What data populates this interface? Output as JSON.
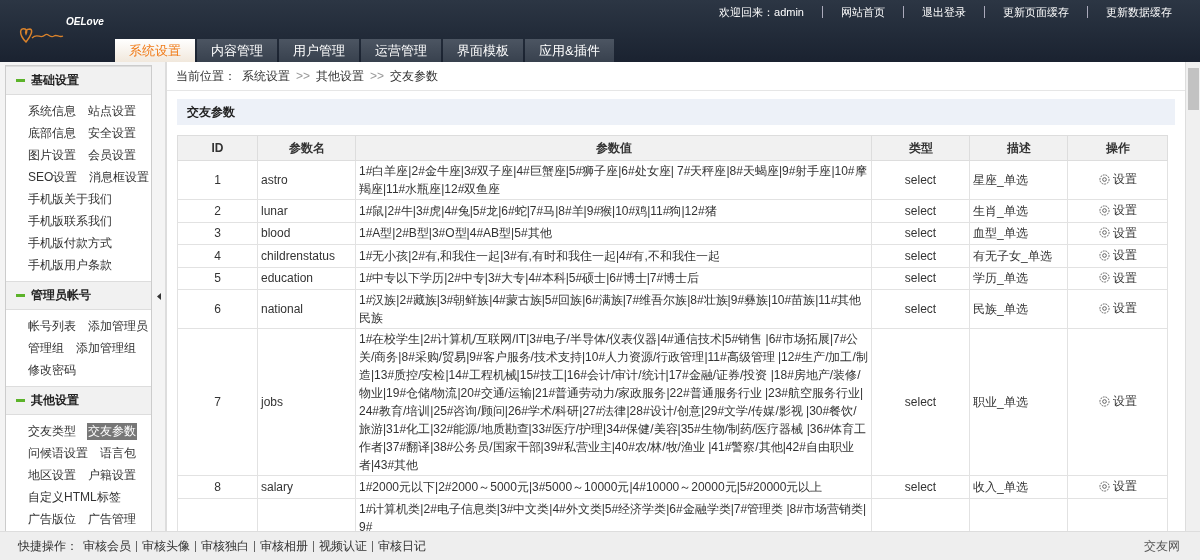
{
  "header": {
    "logo": "OELove",
    "links": [
      "欢迎回来：admin",
      "网站首页",
      "退出登录",
      "更新页面缓存",
      "更新数据缓存"
    ],
    "tabs": [
      {
        "label": "系统设置",
        "selected": true
      },
      {
        "label": "内容管理",
        "selected": false
      },
      {
        "label": "用户管理",
        "selected": false
      },
      {
        "label": "运营管理",
        "selected": false
      },
      {
        "label": "界面模板",
        "selected": false
      },
      {
        "label": "应用&插件",
        "selected": false
      }
    ]
  },
  "sidebar": {
    "groups": [
      {
        "title": "基础设置",
        "expanded": true,
        "rows": [
          [
            {
              "label": "系统信息",
              "selected": false
            },
            {
              "label": "站点设置",
              "selected": false
            }
          ],
          [
            {
              "label": "底部信息",
              "selected": false
            },
            {
              "label": "安全设置",
              "selected": false
            }
          ],
          [
            {
              "label": "图片设置",
              "selected": false
            },
            {
              "label": "会员设置",
              "selected": false
            }
          ],
          [
            {
              "label": "SEO设置",
              "selected": false
            },
            {
              "label": "消息框设置",
              "selected": false
            }
          ],
          [
            {
              "label": "手机版关于我们",
              "selected": false
            }
          ],
          [
            {
              "label": "手机版联系我们",
              "selected": false
            }
          ],
          [
            {
              "label": "手机版付款方式",
              "selected": false
            }
          ],
          [
            {
              "label": "手机版用户条款",
              "selected": false
            }
          ]
        ]
      },
      {
        "title": "管理员帐号",
        "expanded": true,
        "rows": [
          [
            {
              "label": "帐号列表",
              "selected": false
            },
            {
              "label": "添加管理员",
              "selected": false
            }
          ],
          [
            {
              "label": "管理组",
              "selected": false
            },
            {
              "label": "添加管理组",
              "selected": false
            }
          ],
          [
            {
              "label": "修改密码",
              "selected": false
            }
          ]
        ]
      },
      {
        "title": "其他设置",
        "expanded": true,
        "rows": [
          [
            {
              "label": "交友类型",
              "selected": false
            },
            {
              "label": "交友参数",
              "selected": true
            }
          ],
          [
            {
              "label": "问候语设置",
              "selected": false
            },
            {
              "label": "语言包",
              "selected": false
            }
          ],
          [
            {
              "label": "地区设置",
              "selected": false
            },
            {
              "label": "户籍设置",
              "selected": false
            }
          ],
          [
            {
              "label": "自定义HTML标签",
              "selected": false
            }
          ],
          [
            {
              "label": "广告版位",
              "selected": false
            },
            {
              "label": "广告管理",
              "selected": false
            }
          ]
        ]
      }
    ]
  },
  "breadcrumb": [
    {
      "kind": "label",
      "text": "当前位置："
    },
    {
      "kind": "link",
      "text": "系统设置"
    },
    {
      "kind": "sep",
      "text": ">>"
    },
    {
      "kind": "link",
      "text": "其他设置"
    },
    {
      "kind": "sep",
      "text": ">>"
    },
    {
      "kind": "link",
      "text": "交友参数"
    }
  ],
  "section_title": "交友参数",
  "table": {
    "columns": [
      "ID",
      "参数名",
      "参数值",
      "类型",
      "描述",
      "操作"
    ],
    "rows": [
      {
        "id": "1",
        "name": "astro",
        "value": "1#白羊座|2#金牛座|3#双子座|4#巨蟹座|5#狮子座|6#处女座| 7#天秤座|8#天蝎座|9#射手座|10#摩羯座|11#水瓶座|12#双鱼座",
        "type": "select",
        "desc": "星座_单选",
        "action": "设置"
      },
      {
        "id": "2",
        "name": "lunar",
        "value": "1#鼠|2#牛|3#虎|4#兔|5#龙|6#蛇|7#马|8#羊|9#猴|10#鸡|11#狗|12#猪",
        "type": "select",
        "desc": "生肖_单选",
        "action": "设置"
      },
      {
        "id": "3",
        "name": "blood",
        "value": "1#A型|2#B型|3#O型|4#AB型|5#其他",
        "type": "select",
        "desc": "血型_单选",
        "action": "设置"
      },
      {
        "id": "4",
        "name": "childrenstatus",
        "value": "1#无小孩|2#有,和我住一起|3#有,有时和我住一起|4#有,不和我住一起",
        "type": "select",
        "desc": "有无子女_单选",
        "action": "设置"
      },
      {
        "id": "5",
        "name": "education",
        "value": "1#中专以下学历|2#中专|3#大专|4#本科|5#硕士|6#博士|7#博士后",
        "type": "select",
        "desc": "学历_单选",
        "action": "设置"
      },
      {
        "id": "6",
        "name": "national",
        "value": "1#汉族|2#藏族|3#朝鲜族|4#蒙古族|5#回族|6#满族|7#维吾尔族|8#壮族|9#彝族|10#苗族|11#其他民族",
        "type": "select",
        "desc": "民族_单选",
        "action": "设置"
      },
      {
        "id": "7",
        "name": "jobs",
        "value": "1#在校学生|2#计算机/互联网/IT|3#电子/半导体/仪表仪器|4#通信技术|5#销售 |6#市场拓展|7#公关/商务|8#采购/贸易|9#客户服务/技术支持|10#人力资源/行政管理|11#高级管理 |12#生产/加工/制造|13#质控/安检|14#工程机械|15#技工|16#会计/审计/统计|17#金融/证券/投资 |18#房地产/装修/物业|19#仓储/物流|20#交通/运输|21#普通劳动力/家政服务|22#普通服务行业 |23#航空服务行业|24#教育/培训|25#咨询/顾问|26#学术/科研|27#法律|28#设计/创意|29#文学/传媒/影视 |30#餐饮/旅游|31#化工|32#能源/地质勘查|33#医疗/护理|34#保健/美容|35#生物/制药/医疗器械 |36#体育工作者|37#翻译|38#公务员/国家干部|39#私营业主|40#农/林/牧/渔业 |41#警察/其他|42#自由职业者|43#其他",
        "type": "select",
        "desc": "职业_单选",
        "action": "设置"
      },
      {
        "id": "8",
        "name": "salary",
        "value": "1#2000元以下|2#2000～5000元|3#5000～10000元|4#10000～20000元|5#20000元以上",
        "type": "select",
        "desc": "收入_单选",
        "action": "设置"
      },
      {
        "value": "1#计算机类|2#电子信息类|3#中文类|4#外文类|5#经济学类|6#金融学类|7#管理类 |8#市场营销类|9#"
      }
    ]
  },
  "footer": {
    "label": "快捷操作：",
    "links": [
      "审核会员",
      "审核头像",
      "审核独白",
      "审核相册",
      "视频认证",
      "审核日记"
    ],
    "brand": "交友网"
  }
}
